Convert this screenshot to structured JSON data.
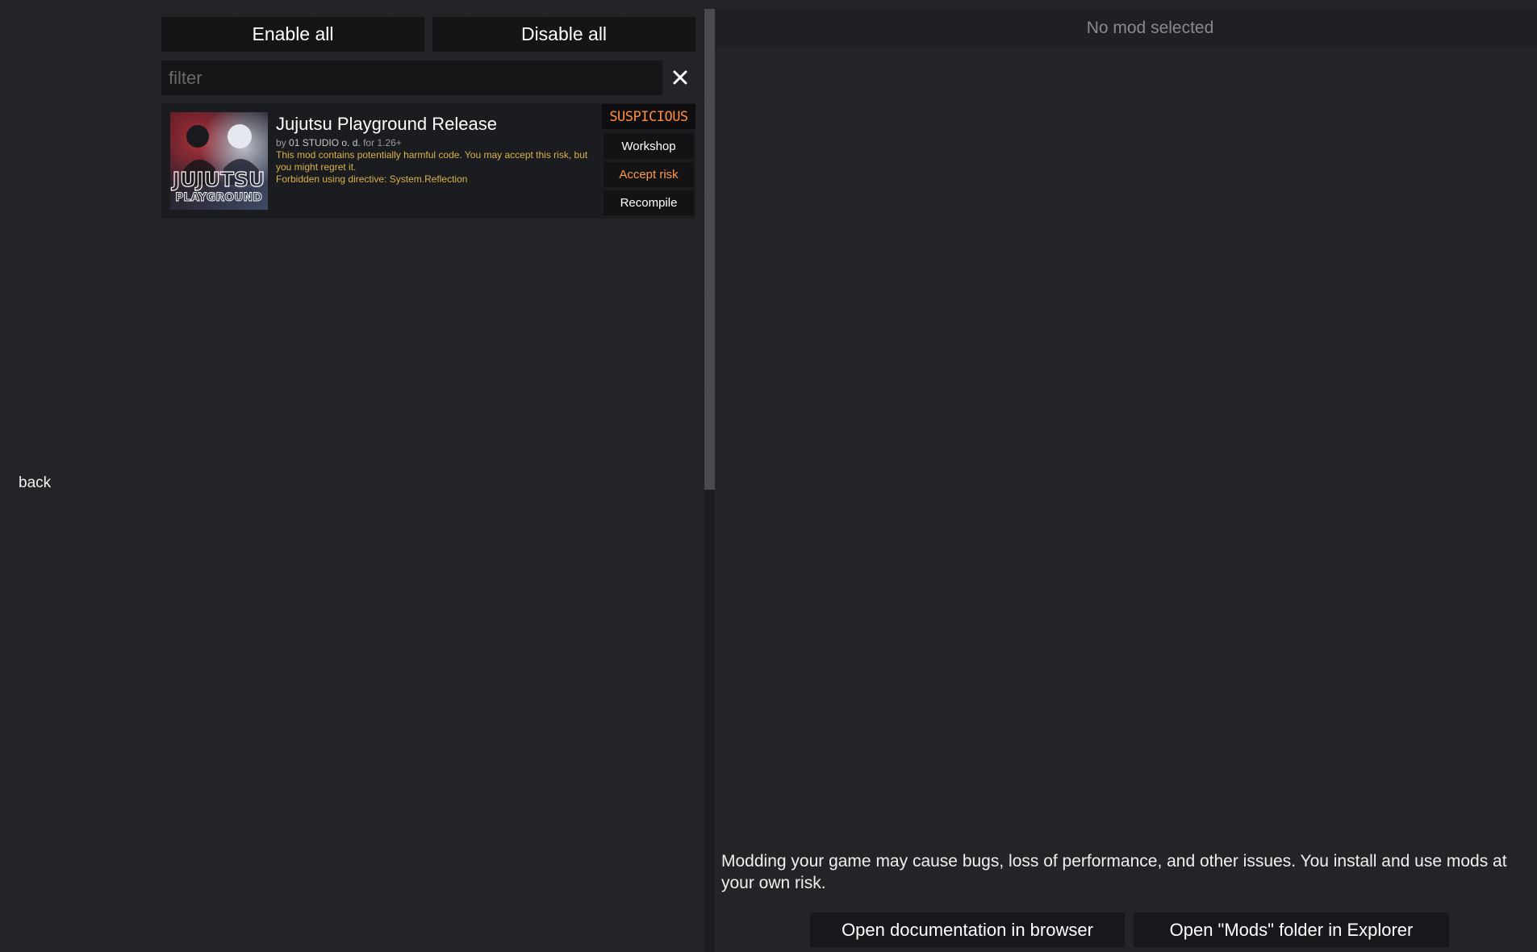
{
  "nav": {
    "back_label": "back"
  },
  "toolbar": {
    "enable_all_label": "Enable all",
    "disable_all_label": "Disable all"
  },
  "filter": {
    "placeholder": "filter",
    "value": "",
    "clear_icon": "close-icon"
  },
  "mods": [
    {
      "title": "Jujutsu Playground Release",
      "by_prefix": "by",
      "author": "01 STUDIO o. d.",
      "for_version": "for 1.26+",
      "warning": "This mod contains potentially harmful code. You may accept this risk, but you might regret it.",
      "directive": "Forbidden using directive: System.Reflection",
      "thumbnail_text_top": "JUJUTSU",
      "thumbnail_text_bottom": "PLAYGROUND",
      "status_badge": "SUSPICIOUS",
      "actions": {
        "workshop_label": "Workshop",
        "accept_risk_label": "Accept risk",
        "recompile_label": "Recompile"
      }
    }
  ],
  "detail": {
    "empty_label": "No mod selected"
  },
  "footer": {
    "disclaimer": "Modding your game may cause bugs, loss of performance, and other issues. You install and use mods at your own risk.",
    "open_docs_label": "Open documentation in browser",
    "open_folder_label": "Open \"Mods\" folder in Explorer"
  },
  "colors": {
    "background": "#232427",
    "button_bg": "#151517",
    "suspicious": "#ff8c3a",
    "warning_text": "#d8b24a",
    "accept_risk": "#ff9a45"
  }
}
